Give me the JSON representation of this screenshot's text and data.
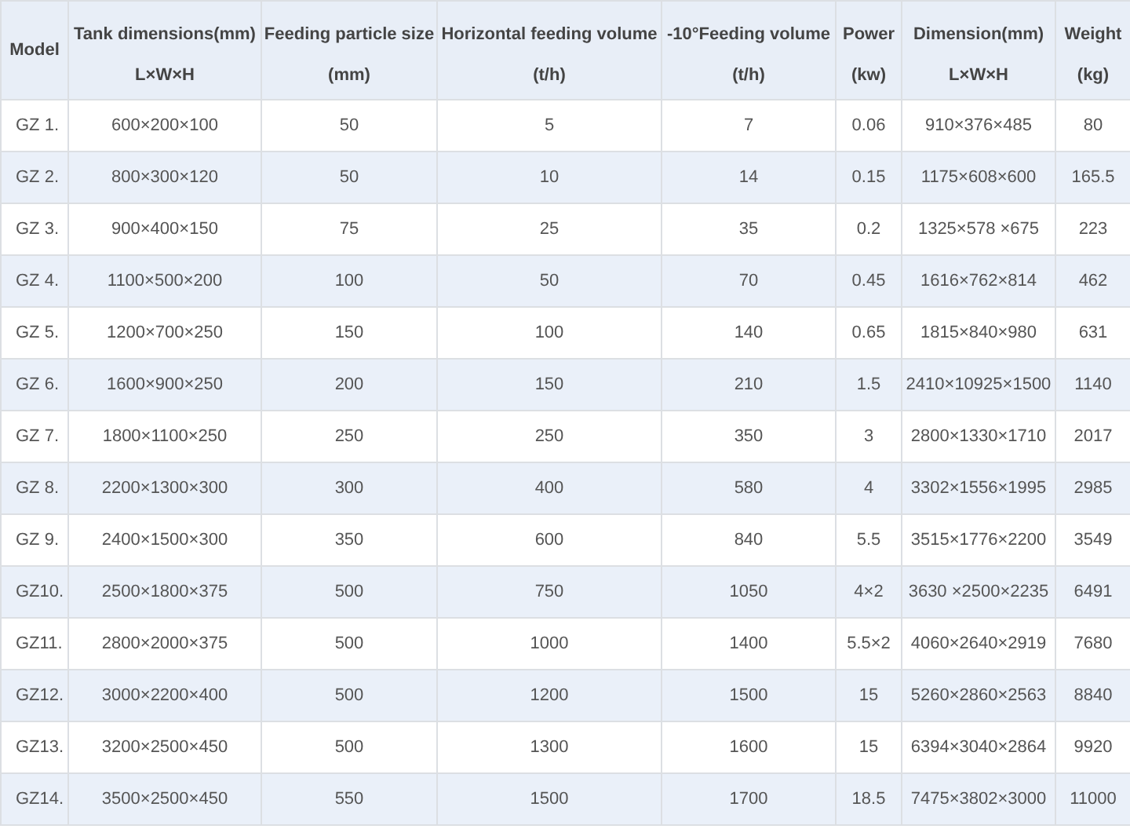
{
  "table": {
    "columns": [
      {
        "title": "Model"
      },
      {
        "title": "Tank dimensions(mm)",
        "unit": "L×W×H"
      },
      {
        "title": "Feeding particle size",
        "unit": "(mm)"
      },
      {
        "title": "Horizontal feeding volume",
        "unit": "(t/h)"
      },
      {
        "title": "-10°Feeding volume",
        "unit": "(t/h)"
      },
      {
        "title": "Power",
        "unit": "(kw)"
      },
      {
        "title": "Dimension(mm)",
        "unit": "L×W×H"
      },
      {
        "title": "Weight",
        "unit": "(kg)"
      }
    ],
    "rows": [
      [
        "GZ 1.",
        "600×200×100",
        "50",
        "5",
        "7",
        "0.06",
        "910×376×485",
        "80"
      ],
      [
        "GZ 2.",
        "800×300×120",
        "50",
        "10",
        "14",
        "0.15",
        "1175×608×600",
        "165.5"
      ],
      [
        "GZ 3.",
        "900×400×150",
        "75",
        "25",
        "35",
        "0.2",
        "1325×578 ×675",
        "223"
      ],
      [
        "GZ 4.",
        "1100×500×200",
        "100",
        "50",
        "70",
        "0.45",
        "1616×762×814",
        "462"
      ],
      [
        "GZ 5.",
        "1200×700×250",
        "150",
        "100",
        "140",
        "0.65",
        "1815×840×980",
        "631"
      ],
      [
        "GZ 6.",
        "1600×900×250",
        "200",
        "150",
        "210",
        "1.5",
        "2410×10925×1500",
        "1140"
      ],
      [
        "GZ 7.",
        "1800×1100×250",
        "250",
        "250",
        "350",
        "3",
        "2800×1330×1710",
        "2017"
      ],
      [
        "GZ 8.",
        "2200×1300×300",
        "300",
        "400",
        "580",
        "4",
        "3302×1556×1995",
        "2985"
      ],
      [
        "GZ 9.",
        "2400×1500×300",
        "350",
        "600",
        "840",
        "5.5",
        "3515×1776×2200",
        "3549"
      ],
      [
        "GZ10.",
        "2500×1800×375",
        "500",
        "750",
        "1050",
        "4×2",
        "3630 ×2500×2235",
        "6491"
      ],
      [
        "GZ11.",
        "2800×2000×375",
        "500",
        "1000",
        "1400",
        "5.5×2",
        "4060×2640×2919",
        "7680"
      ],
      [
        "GZ12.",
        "3000×2200×400",
        "500",
        "1200",
        "1500",
        "15",
        "5260×2860×2563",
        "8840"
      ],
      [
        "GZ13.",
        "3200×2500×450",
        "500",
        "1300",
        "1600",
        "15",
        "6394×3040×2864",
        "9920"
      ],
      [
        "GZ14.",
        "3500×2500×450",
        "550",
        "1500",
        "1700",
        "18.5",
        "7475×3802×3000",
        "11000"
      ]
    ]
  }
}
